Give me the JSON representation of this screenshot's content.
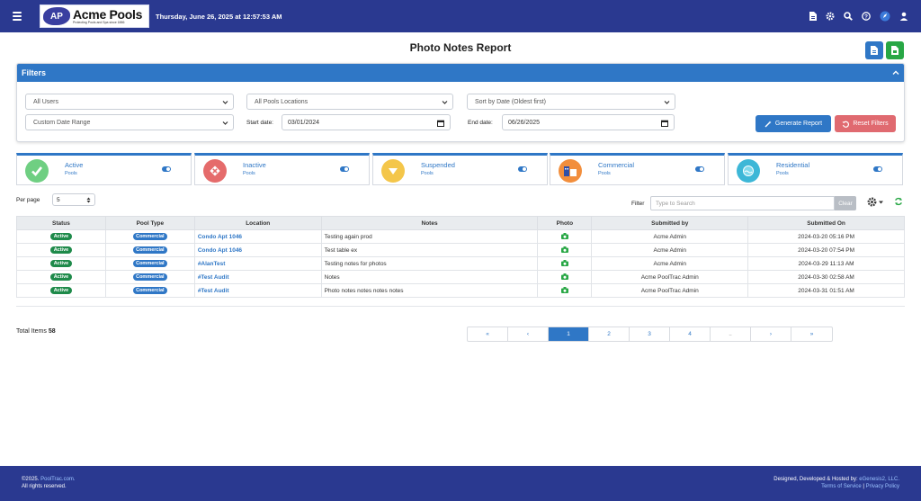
{
  "header": {
    "logo_initials": "AP",
    "logo_name": "Acme Pools",
    "logo_tagline": "Protecting Pools and Spa since 1886",
    "datetime": "Thursday, June 26, 2025 at 12:57:53 AM",
    "icons": [
      "menu-icon",
      "document-icon",
      "gear-icon",
      "search-icon",
      "help-icon",
      "rocket-icon",
      "user-icon"
    ]
  },
  "page": {
    "title": "Photo Notes Report"
  },
  "filters": {
    "title": "Filters",
    "users_select": "All Users",
    "locations_select": "All Pools Locations",
    "sort_select": "Sort by Date (Oldest first)",
    "range_select": "Custom Date Range",
    "start_label": "Start date:",
    "start_value": "03/01/2024",
    "end_label": "End date:",
    "end_value": "06/26/2025",
    "generate_label": "Generate Report",
    "reset_label": "Reset Filters"
  },
  "cards": [
    {
      "title": "Active",
      "sub": "Pools",
      "icon": "check-icon",
      "color": "#6fcf82"
    },
    {
      "title": "Inactive",
      "sub": "Pools",
      "icon": "x-icon",
      "color": "#e56b6b"
    },
    {
      "title": "Suspended",
      "sub": "Pools",
      "icon": "pause-icon",
      "color": "#f4c64a"
    },
    {
      "title": "Commercial",
      "sub": "Pools",
      "icon": "building-icon",
      "color": "#f28e3c"
    },
    {
      "title": "Residential",
      "sub": "Pools",
      "icon": "pool-icon",
      "color": "#3db7d7"
    }
  ],
  "controls": {
    "per_page_label": "Per page",
    "per_page_value": "5",
    "filter_label": "Filter",
    "search_placeholder": "Type to Search",
    "clear_label": "Clear"
  },
  "table": {
    "headers": [
      "Status",
      "Pool Type",
      "Location",
      "Notes",
      "Photo",
      "Submitted by",
      "Submitted On"
    ],
    "rows": [
      {
        "status": "Active",
        "type": "Commercial",
        "location": "Condo Apt 1046",
        "notes": "Testing again prod",
        "by": "Acme Admin",
        "on": "2024-03-20 05:16 PM"
      },
      {
        "status": "Active",
        "type": "Commercial",
        "location": "Condo Apt 1046",
        "notes": "Test table ex",
        "by": "Acme Admin",
        "on": "2024-03-20 07:54 PM"
      },
      {
        "status": "Active",
        "type": "Commercial",
        "location": "#AlanTest",
        "notes": "Testing notes for photos",
        "by": "Acme Admin",
        "on": "2024-03-29 11:13 AM"
      },
      {
        "status": "Active",
        "type": "Commercial",
        "location": "#Test Audit",
        "notes": "Notes",
        "by": "Acme PoolTrac Admin",
        "on": "2024-03-30 02:58 AM"
      },
      {
        "status": "Active",
        "type": "Commercial",
        "location": "#Test Audit",
        "notes": "Photo notes notes notes notes",
        "by": "Acme PoolTrac Admin",
        "on": "2024-03-31 01:51 AM"
      }
    ]
  },
  "summary": {
    "total_label": "Total Items",
    "total_value": "58"
  },
  "pagination": [
    "«",
    "‹",
    "1",
    "2",
    "3",
    "4",
    "..",
    "›",
    "»"
  ],
  "footer": {
    "copyright_prefix": "©2025.",
    "copyright_link": "PoolTrac.com.",
    "rights": "All rights reserved.",
    "designed_prefix": "Designed, Developed & Hosted by:",
    "designed_link": "eGenesis2, LLC.",
    "terms": "Terms of Service",
    "separator": "|",
    "privacy": "Privacy Policy"
  },
  "colors": {
    "brand": "#2a3990",
    "accent": "#2f77c6",
    "success": "#28a745",
    "danger": "#e06a70"
  }
}
